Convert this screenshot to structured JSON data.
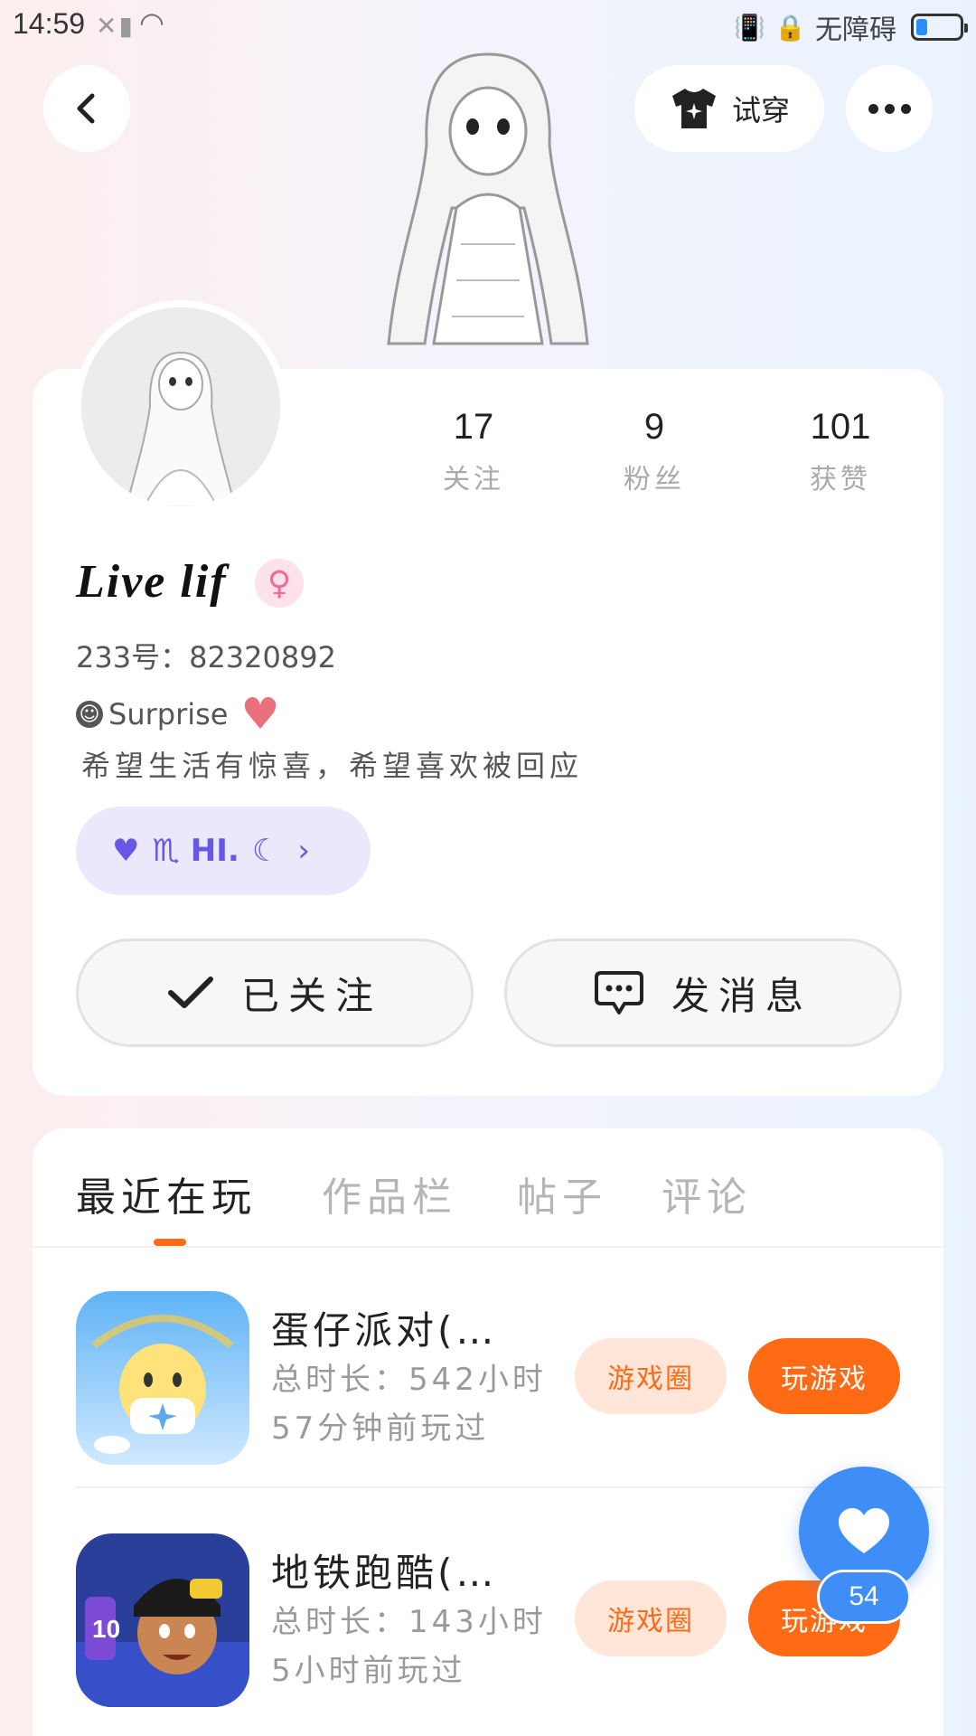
{
  "status_bar": {
    "time": "14:59",
    "accessibility_label": "无障碍",
    "battery_level": 0.25
  },
  "header": {
    "tryon_label": "试穿"
  },
  "profile": {
    "username": "Live  lif",
    "gender_symbol": "♀",
    "id_line": "233号：82320892",
    "bio_line1": "Surprise",
    "bio_line2": "希望生活有惊喜，希望喜欢被回应",
    "tag_text": "♏ HI.",
    "stats": [
      {
        "value": "17",
        "label": "关注"
      },
      {
        "value": "9",
        "label": "粉丝"
      },
      {
        "value": "101",
        "label": "获赞"
      }
    ],
    "follow_button": "已关注",
    "message_button": "发消息"
  },
  "tabs": [
    {
      "label": "最近在玩",
      "active": true
    },
    {
      "label": "作品栏",
      "active": false
    },
    {
      "label": "帖子",
      "active": false
    },
    {
      "label": "评论",
      "active": false
    }
  ],
  "games": [
    {
      "name": "蛋仔派对(…",
      "total_time": "总时长：542小时",
      "last_played": "57分钟前玩过",
      "circle_label": "游戏圈",
      "play_label": "玩游戏"
    },
    {
      "name": "地铁跑酷(…",
      "total_time": "总时长：143小时",
      "last_played": "5小时前玩过",
      "circle_label": "游戏圈",
      "play_label": "玩游戏"
    }
  ],
  "like_fab": {
    "count": "54"
  },
  "colors": {
    "accent_orange": "#ff6a15",
    "like_blue": "#3f8ef7",
    "tag_purple": "#6757e6"
  }
}
